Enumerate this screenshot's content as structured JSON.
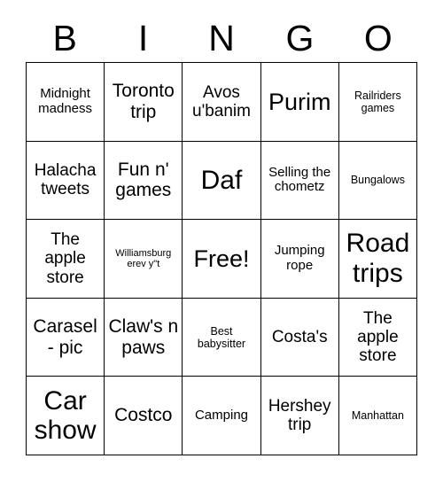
{
  "card": {
    "title": "BINGO",
    "header_letters": [
      "B",
      "I",
      "N",
      "G",
      "O"
    ],
    "grid_size": "5x5",
    "colors": {
      "background": "#ffffff",
      "text": "#000000",
      "border": "#000000"
    },
    "rows": [
      [
        {
          "text": "Midnight madness",
          "size": "fs-xs",
          "free": false
        },
        {
          "text": "Toronto trip",
          "size": "fs-md",
          "free": false
        },
        {
          "text": "Avos u'banim",
          "size": "fs-sm",
          "free": false
        },
        {
          "text": "Purim",
          "size": "fs-lg",
          "free": false
        },
        {
          "text": "Railriders games",
          "size": "fs-xxs",
          "free": false
        }
      ],
      [
        {
          "text": "Halacha tweets",
          "size": "fs-sm",
          "free": false
        },
        {
          "text": "Fun n' games",
          "size": "fs-md",
          "free": false
        },
        {
          "text": "Daf",
          "size": "fs-xl",
          "free": false
        },
        {
          "text": "Selling the chometz",
          "size": "fs-xs",
          "free": false
        },
        {
          "text": "Bungalows",
          "size": "fs-xxs",
          "free": false
        }
      ],
      [
        {
          "text": "The apple store",
          "size": "fs-sm",
          "free": false
        },
        {
          "text": "Williamsburg erev y\"t",
          "size": "fs-tiny",
          "free": false
        },
        {
          "text": "Free!",
          "size": "fs-lg",
          "free": true
        },
        {
          "text": "Jumping rope",
          "size": "fs-xs",
          "free": false
        },
        {
          "text": "Road trips",
          "size": "fs-xl",
          "free": false
        }
      ],
      [
        {
          "text": "Carasel - pic",
          "size": "fs-md",
          "free": false
        },
        {
          "text": "Claw's n paws",
          "size": "fs-md",
          "free": false
        },
        {
          "text": "Best babysitter",
          "size": "fs-xxs",
          "free": false
        },
        {
          "text": "Costa's",
          "size": "fs-sm",
          "free": false
        },
        {
          "text": "The apple store",
          "size": "fs-sm",
          "free": false
        }
      ],
      [
        {
          "text": "Car show",
          "size": "fs-xl",
          "free": false
        },
        {
          "text": "Costco",
          "size": "fs-md",
          "free": false
        },
        {
          "text": "Camping",
          "size": "fs-xs",
          "free": false
        },
        {
          "text": "Hershey trip",
          "size": "fs-sm",
          "free": false
        },
        {
          "text": "Manhattan",
          "size": "fs-xxs",
          "free": false
        }
      ]
    ]
  }
}
